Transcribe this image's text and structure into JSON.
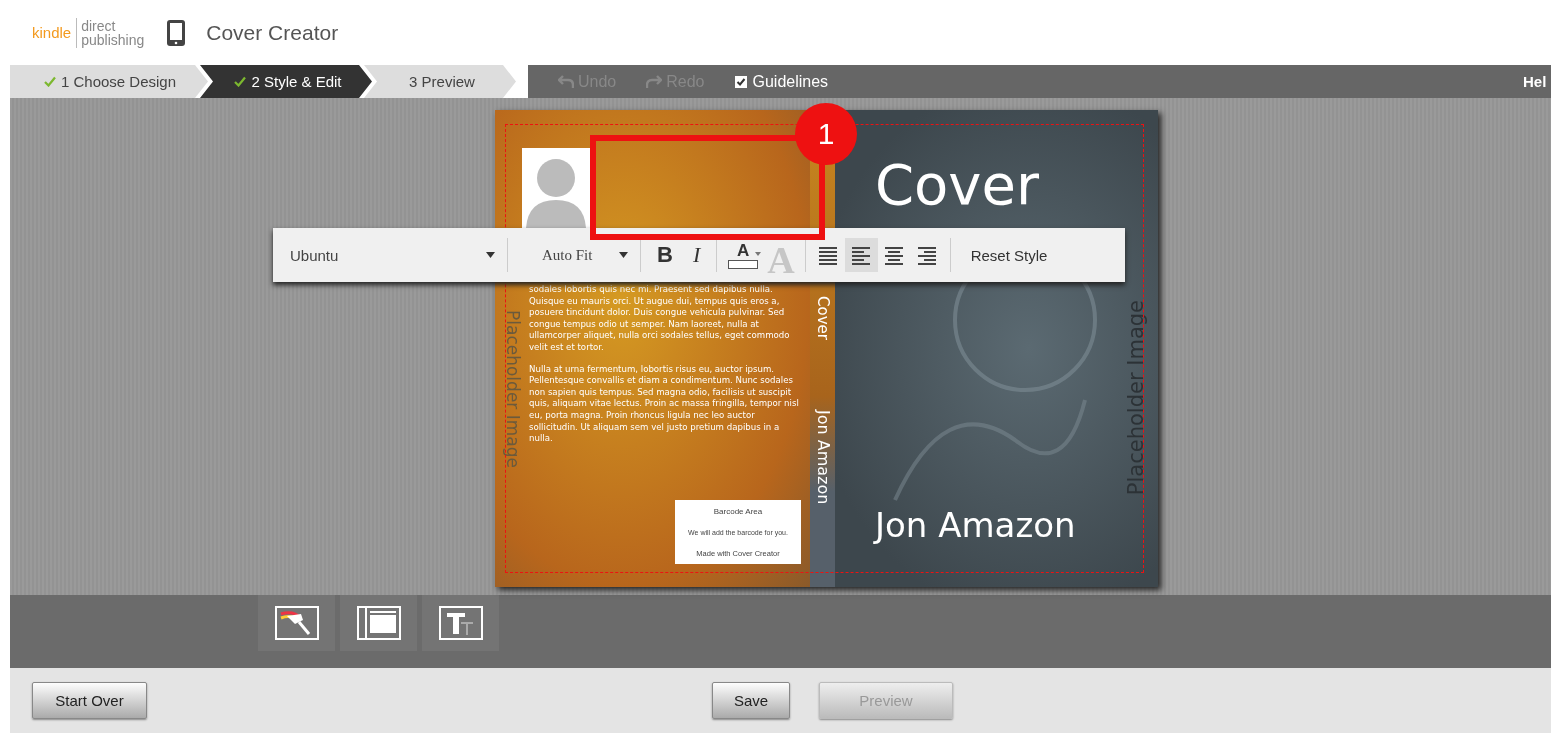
{
  "header": {
    "brand_word": "kindle",
    "brand_lines": [
      "direct",
      "publishing"
    ],
    "title": "Cover Creator"
  },
  "steps": [
    {
      "label": "1 Choose Design",
      "done": true,
      "selected": false
    },
    {
      "label": "2 Style & Edit",
      "done": true,
      "selected": true
    },
    {
      "label": "3 Preview",
      "done": false,
      "selected": false
    }
  ],
  "toolbar": {
    "undo": {
      "label": "Undo",
      "disabled": true
    },
    "redo": {
      "label": "Redo",
      "disabled": true
    },
    "guidelines": {
      "label": "Guidelines",
      "checked": true
    },
    "help": "Hel"
  },
  "cover": {
    "back": {
      "placeholder": "Placeholder Image",
      "paragraphs": [
        "sodales lobortis quis nec mi. Praesent sed dapibus nulla. Quisque eu mauris orci. Ut augue dui, tempus quis eros a, posuere tincidunt dolor. Duis congue vehicula pulvinar. Sed congue tempus odio ut semper. Nam laoreet, nulla at ullamcorper aliquet, nulla orci sodales tellus, eget commodo velit est et tortor.",
        "Nulla at urna fermentum, lobortis risus eu, auctor ipsum. Pellentesque convallis et diam a condimentum. Nunc sodales non sapien quis tempus. Sed magna odio, facilisis ut suscipit quis, aliquam vitae lectus. Proin ac massa fringilla, tempor nisl eu, porta magna. Proin rhoncus ligula nec leo auctor sollicitudin. Ut aliquam sem vel justo pretium dapibus in a nulla."
      ],
      "barcode": {
        "title": "Barcode Area",
        "note": "We will add the barcode for you.",
        "credit": "Made with Cover Creator"
      }
    },
    "spine": {
      "title": "Cover",
      "author": "Jon Amazon"
    },
    "front": {
      "title": "Cover",
      "placeholder": "Placeholder Image",
      "author": "Jon Amazon"
    }
  },
  "format_toolbar": {
    "font": "Ubuntu",
    "size": "Auto Fit",
    "bold": "B",
    "italic": "I",
    "color_label": "A",
    "color": "#ffffff",
    "shadow_label": "A",
    "align": [
      {
        "kind": "justify",
        "selected": false
      },
      {
        "kind": "left",
        "selected": true
      },
      {
        "kind": "center",
        "selected": false
      },
      {
        "kind": "right",
        "selected": false
      }
    ],
    "reset": "Reset Style"
  },
  "annotation": {
    "number": "1"
  },
  "tools": [
    {
      "kind": "theme"
    },
    {
      "kind": "layout"
    },
    {
      "kind": "text"
    }
  ],
  "footer": {
    "start_over": "Start Over",
    "save": "Save",
    "preview": {
      "label": "Preview",
      "disabled": true
    }
  }
}
